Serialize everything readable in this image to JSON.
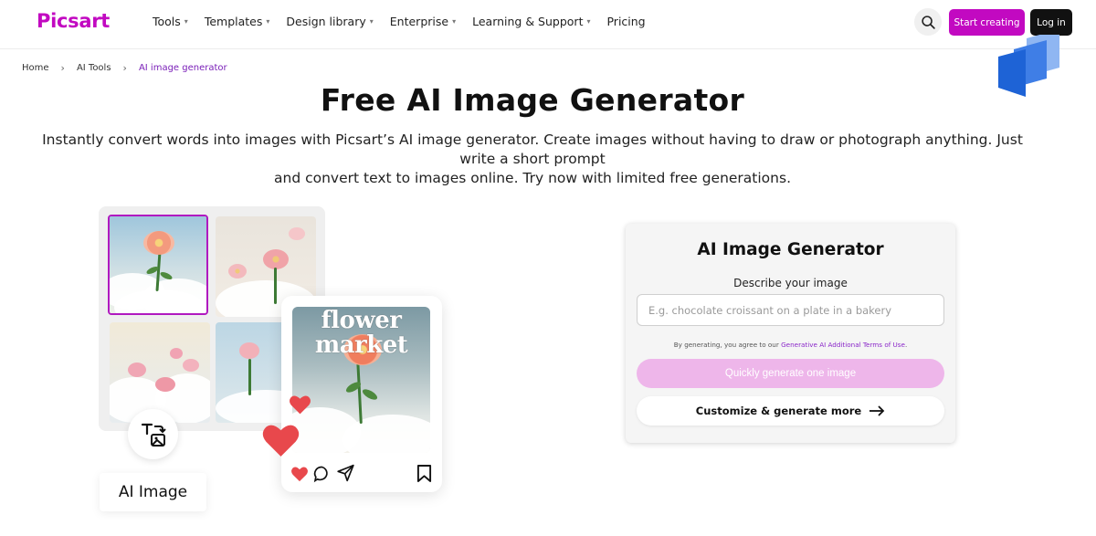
{
  "brand": {
    "logo_text": "Picsart",
    "accent": "#c209c1"
  },
  "nav": {
    "items": [
      {
        "label": "Tools",
        "has_dropdown": true
      },
      {
        "label": "Templates",
        "has_dropdown": true
      },
      {
        "label": "Design library",
        "has_dropdown": true
      },
      {
        "label": "Enterprise",
        "has_dropdown": true
      },
      {
        "label": "Learning & Support",
        "has_dropdown": true
      },
      {
        "label": "Pricing",
        "has_dropdown": false
      }
    ],
    "search_icon": "search-icon",
    "start_label": "Start creating",
    "login_label": "Log in"
  },
  "breadcrumb": {
    "items": [
      "Home",
      "AI Tools",
      "AI image generator"
    ]
  },
  "hero": {
    "title": "Free AI Image Generator",
    "subtitle_line1": "Instantly convert words into images with Picsart’s AI image generator. Create images without having to draw or photograph anything. Just write a short prompt",
    "subtitle_line2": "and convert text to images online. Try now with limited free generations."
  },
  "illustration": {
    "label": "AI Image",
    "post_text": "flower market"
  },
  "generator": {
    "title": "AI Image Generator",
    "describe_label": "Describe your image",
    "input_placeholder": "E.g. chocolate croissant on a plate in a bakery",
    "input_value": "",
    "terms_prefix": "By generating, you agree to our ",
    "terms_link": "Generative AI Additional Terms of Use",
    "terms_suffix": ".",
    "quick_button": "Quickly generate one image",
    "customize_button": "Customize & generate more"
  },
  "colors": {
    "quick_button_bg": "#eeb6ea",
    "breadcrumb_current": "#7a1fb8",
    "heart": "#e8484c",
    "layers_dark": "#1e63d6",
    "layers_light": "#8fb6f2"
  }
}
